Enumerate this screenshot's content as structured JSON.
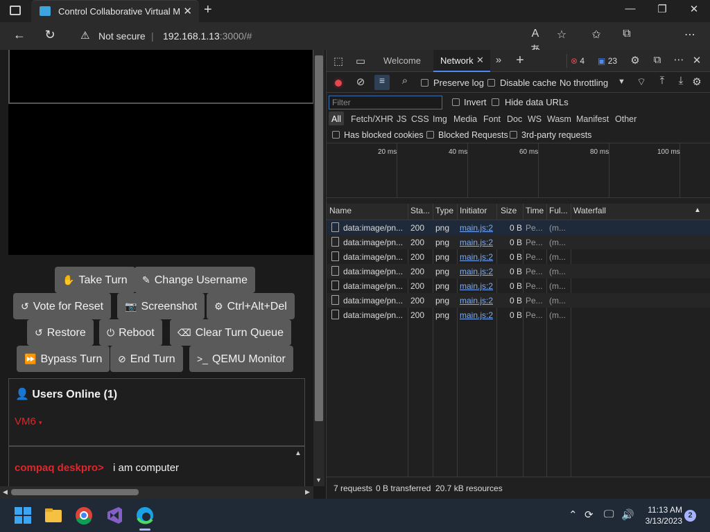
{
  "browser": {
    "tab_title": "Control Collaborative Virtual Ma",
    "tab_close": "✕",
    "new_tab": "+",
    "security": "Not secure",
    "url_host": "192.168.1.13",
    "url_rest": ":3000/#"
  },
  "page": {
    "buttons": [
      {
        "label": "Take Turn",
        "icon": "hand-icon"
      },
      {
        "label": "Change Username",
        "icon": "user-edit-icon"
      },
      {
        "label": "Vote for Reset",
        "icon": "undo-icon"
      },
      {
        "label": "Screenshot",
        "icon": "camera-icon"
      },
      {
        "label": "Ctrl+Alt+Del",
        "icon": "gear-icon"
      },
      {
        "label": "Restore",
        "icon": "restore-icon"
      },
      {
        "label": "Reboot",
        "icon": "power-icon"
      },
      {
        "label": "Clear Turn Queue",
        "icon": "eraser-icon"
      },
      {
        "label": "Bypass Turn",
        "icon": "fast-forward-icon"
      },
      {
        "label": "End Turn",
        "icon": "ban-icon"
      },
      {
        "label": "QEMU Monitor",
        "icon": "terminal-icon"
      }
    ],
    "users_header": "Users Online (1)",
    "vm_name": "VM6",
    "chat_user": "compaq deskpro>",
    "chat_message": "i am computer"
  },
  "devtools": {
    "tabs": {
      "welcome": "Welcome",
      "network": "Network"
    },
    "errors": "4",
    "messages": "23",
    "preserve_log": "Preserve log",
    "disable_cache": "Disable cache",
    "throttling": "No throttling",
    "filter_placeholder": "Filter",
    "invert": "Invert",
    "hide_data_urls": "Hide data URLs",
    "filter_types": [
      "All",
      "Fetch/XHR",
      "JS",
      "CSS",
      "Img",
      "Media",
      "Font",
      "Doc",
      "WS",
      "Wasm",
      "Manifest",
      "Other"
    ],
    "has_blocked_cookies": "Has blocked cookies",
    "blocked_requests": "Blocked Requests",
    "third_party": "3rd-party requests",
    "ticks": [
      "20 ms",
      "40 ms",
      "60 ms",
      "80 ms",
      "100 ms"
    ],
    "columns": {
      "name": "Name",
      "status": "Sta...",
      "type": "Type",
      "initiator": "Initiator",
      "size": "Size",
      "time": "Time",
      "fulfilled": "Ful...",
      "waterfall": "Waterfall"
    },
    "rows": [
      {
        "name": "data:image/pn...",
        "status": "200",
        "type": "png",
        "initiator": "main.js:2",
        "size": "0 B",
        "time": "Pe...",
        "fulfilled": "(m..."
      },
      {
        "name": "data:image/pn...",
        "status": "200",
        "type": "png",
        "initiator": "main.js:2",
        "size": "0 B",
        "time": "Pe...",
        "fulfilled": "(m..."
      },
      {
        "name": "data:image/pn...",
        "status": "200",
        "type": "png",
        "initiator": "main.js:2",
        "size": "0 B",
        "time": "Pe...",
        "fulfilled": "(m..."
      },
      {
        "name": "data:image/pn...",
        "status": "200",
        "type": "png",
        "initiator": "main.js:2",
        "size": "0 B",
        "time": "Pe...",
        "fulfilled": "(m..."
      },
      {
        "name": "data:image/pn...",
        "status": "200",
        "type": "png",
        "initiator": "main.js:2",
        "size": "0 B",
        "time": "Pe...",
        "fulfilled": "(m..."
      },
      {
        "name": "data:image/pn...",
        "status": "200",
        "type": "png",
        "initiator": "main.js:2",
        "size": "0 B",
        "time": "Pe...",
        "fulfilled": "(m..."
      },
      {
        "name": "data:image/pn...",
        "status": "200",
        "type": "png",
        "initiator": "main.js:2",
        "size": "0 B",
        "time": "Pe...",
        "fulfilled": "(m..."
      }
    ],
    "status": {
      "requests": "7 requests",
      "transferred": "0 B transferred",
      "resources": "20.7 kB resources"
    }
  },
  "taskbar": {
    "time": "11:13 AM",
    "date": "3/13/2023",
    "notifications": "2"
  },
  "colors": {
    "accent": "#4c8bf5",
    "vm_red": "#e0262a",
    "button_gray": "#5a5a5a"
  }
}
